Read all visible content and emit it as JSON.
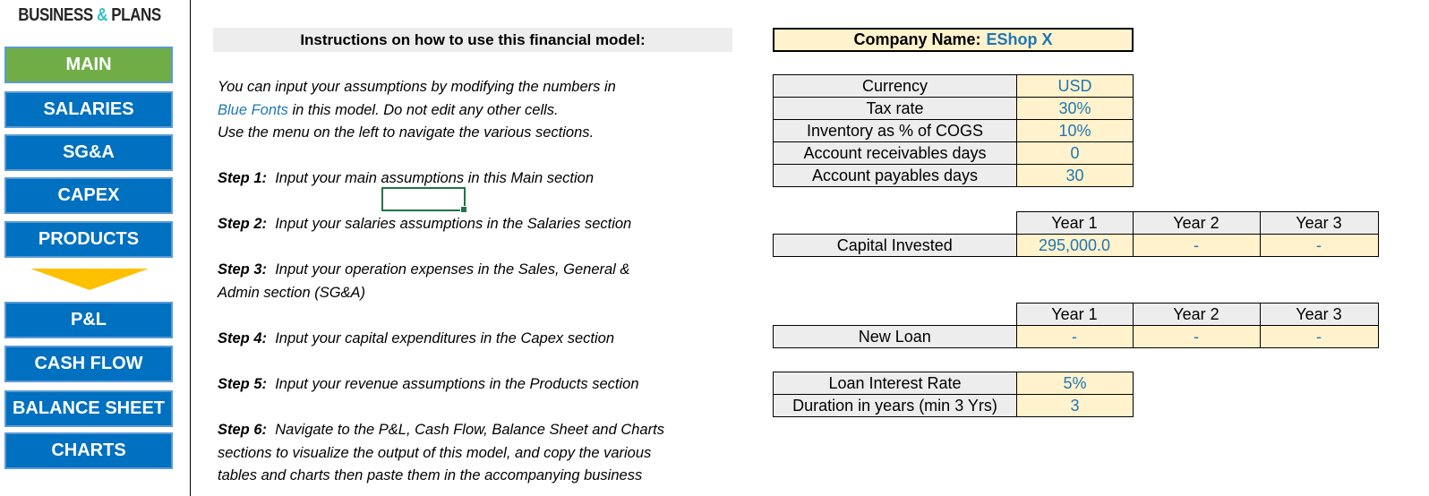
{
  "logo": {
    "left": "BUSINESS",
    "amp": "&",
    "right": "PLANS"
  },
  "nav": {
    "items": [
      {
        "label": "MAIN",
        "active": true
      },
      {
        "label": "SALARIES"
      },
      {
        "label": "SG&A"
      },
      {
        "label": "CAPEX"
      },
      {
        "label": "PRODUCTS"
      },
      {
        "label": "P&L"
      },
      {
        "label": "CASH FLOW"
      },
      {
        "label": "BALANCE SHEET"
      },
      {
        "label": "CHARTS"
      }
    ]
  },
  "instructions": {
    "title": "Instructions on how to use this financial model:",
    "intro_line1": "You can input your assumptions by modifying the numbers in",
    "intro_blue": "Blue Fonts",
    "intro_line2_rest": " in this model. Do not edit any other cells.",
    "intro_line3": "Use the menu on the left to navigate the various sections.",
    "steps": [
      {
        "label": "Step 1:",
        "text": "Input your main assumptions in this Main section"
      },
      {
        "label": "Step 2:",
        "text": "Input your salaries assumptions in the Salaries section"
      },
      {
        "label": "Step 3:",
        "text": "Input your operation expenses in the Sales, General &",
        "text2": "Admin section (SG&A)"
      },
      {
        "label": "Step 4:",
        "text": "Input your capital expenditures in the Capex section"
      },
      {
        "label": "Step 5:",
        "text": "Input your revenue assumptions in the Products section"
      },
      {
        "label": "Step 6:",
        "text": "Navigate to the P&L, Cash Flow, Balance Sheet and Charts",
        "text2": "sections to visualize the output of this model, and copy the various",
        "text3": "tables and charts then paste them in the accompanying business"
      }
    ]
  },
  "company": {
    "label": "Company Name:",
    "value": "EShop X"
  },
  "assumptions": [
    {
      "label": "Currency",
      "value": "USD"
    },
    {
      "label": "Tax rate",
      "value": "30%"
    },
    {
      "label": "Inventory as % of COGS",
      "value": "10%"
    },
    {
      "label": "Account receivables days",
      "value": "0"
    },
    {
      "label": "Account payables days",
      "value": "30"
    }
  ],
  "capital": {
    "years": [
      "Year 1",
      "Year 2",
      "Year 3"
    ],
    "label": "Capital Invested",
    "values": [
      "295,000.0",
      "-",
      "-"
    ]
  },
  "loan": {
    "years": [
      "Year 1",
      "Year 2",
      "Year 3"
    ],
    "label": "New Loan",
    "values": [
      "-",
      "-",
      "-"
    ]
  },
  "loan_terms": [
    {
      "label": "Loan Interest Rate",
      "value": "5%"
    },
    {
      "label": "Duration in years (min 3 Yrs)",
      "value": "3"
    }
  ],
  "colors": {
    "nav_blue": "#0070c0",
    "nav_active": "#70ad47",
    "input_fill": "#fff2cc",
    "input_font": "#1f77b4",
    "arrow": "#ffc000"
  }
}
